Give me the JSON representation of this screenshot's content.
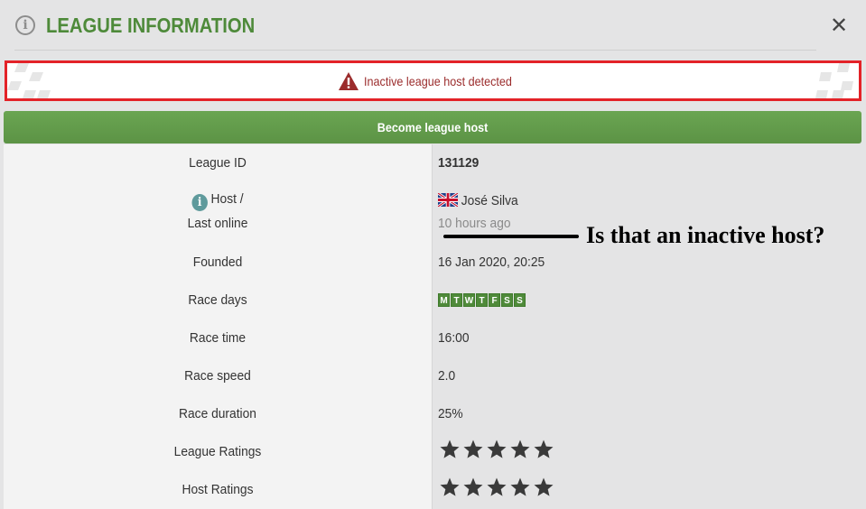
{
  "header": {
    "title": "LEAGUE INFORMATION",
    "info_icon": "i",
    "close_label": "✕"
  },
  "alert": {
    "icon": "warning-triangle-icon",
    "text": "Inactive league host detected",
    "color": "#e32228"
  },
  "action": {
    "become_host_label": "Become league host"
  },
  "rows": {
    "league_id": {
      "label": "League ID",
      "value": "131129"
    },
    "host": {
      "label_line1": "Host /",
      "label_line2": "Last online",
      "name": "José Silva",
      "last_online": "10 hours ago",
      "flag": "uk-flag-icon"
    },
    "founded": {
      "label": "Founded",
      "value": "16 Jan 2020, 20:25"
    },
    "race_days": {
      "label": "Race days",
      "days": [
        "M",
        "T",
        "W",
        "T",
        "F",
        "S",
        "S"
      ]
    },
    "race_time": {
      "label": "Race time",
      "value": "16:00"
    },
    "race_speed": {
      "label": "Race speed",
      "value": "2.0"
    },
    "race_duration": {
      "label": "Race duration",
      "value": "25%"
    },
    "league_ratings": {
      "label": "League Ratings",
      "stars": 5
    },
    "host_ratings": {
      "label": "Host Ratings",
      "stars": 5
    }
  },
  "annotation": {
    "text": "Is that an inactive host?"
  },
  "colors": {
    "accent_green": "#4e8a3a",
    "button_green": "#62a04b",
    "alert_red": "#e32228"
  }
}
